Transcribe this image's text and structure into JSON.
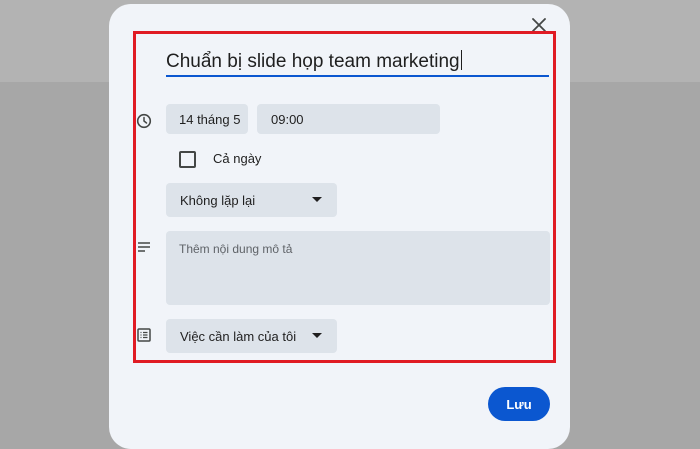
{
  "task_form": {
    "title_value": "Chuẩn bị slide họp team marketing",
    "date_value": "14 tháng 5",
    "time_value": "09:00",
    "all_day_label": "Cả ngày",
    "all_day_checked": false,
    "repeat_value": "Không lặp lại",
    "description_placeholder": "Thêm nội dung mô tả",
    "list_value": "Việc cần làm của tôi",
    "save_label": "Lưu"
  },
  "icons": {
    "close": "close-icon",
    "time": "clock-icon",
    "description": "notes-icon",
    "list": "list-icon"
  },
  "colors": {
    "accent": "#0b57d0",
    "highlight_frame": "#e01b24",
    "dialog_bg": "#f1f4f9",
    "field_bg": "#dde3ea"
  }
}
